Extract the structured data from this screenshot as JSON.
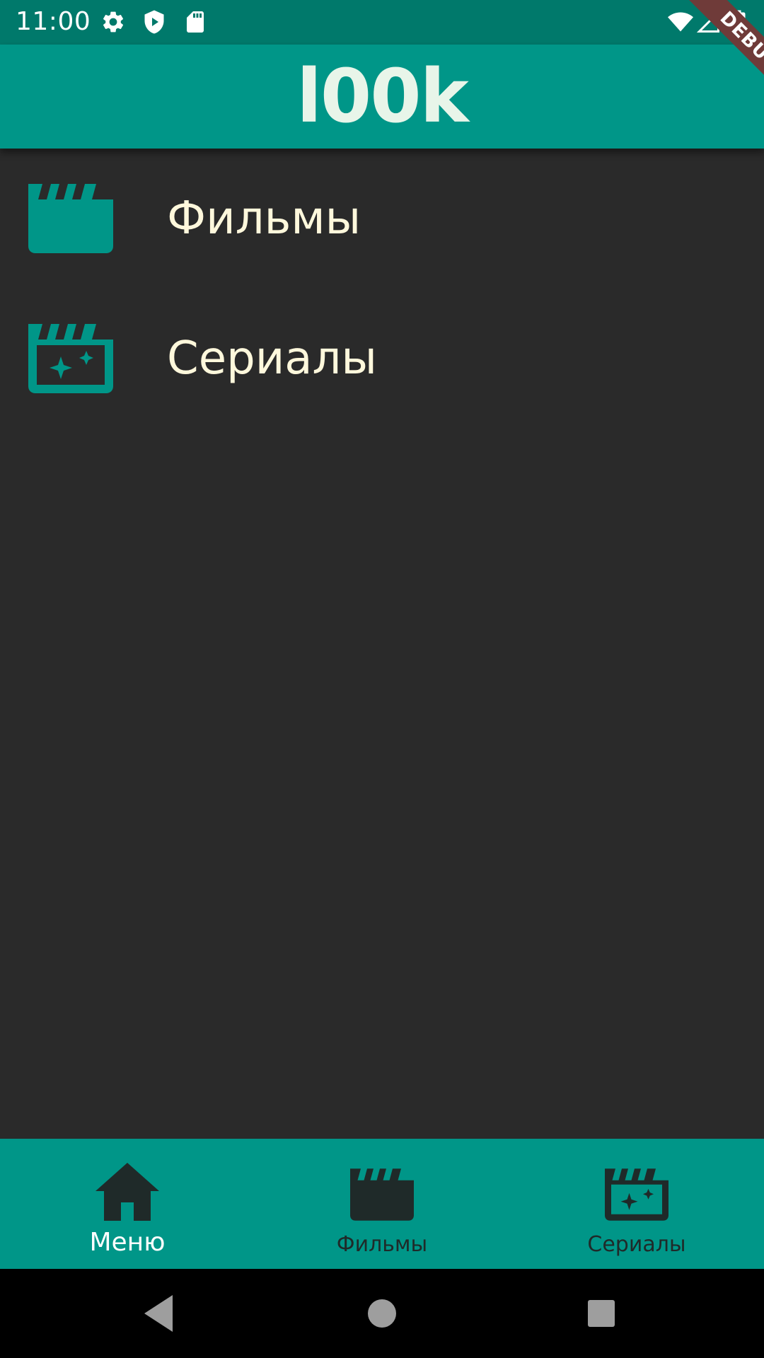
{
  "status_bar": {
    "time": "11:00",
    "icons": [
      "gear-icon",
      "play-protect-icon",
      "sd-card-icon",
      "wifi-icon",
      "signal-icon",
      "battery-icon"
    ]
  },
  "debug_banner": {
    "label": "DEBUG"
  },
  "app_bar": {
    "title": "l00k"
  },
  "menu": {
    "items": [
      {
        "label": "Фильмы",
        "icon": "movie-clapper-icon"
      },
      {
        "label": "Сериалы",
        "icon": "series-clapper-icon"
      }
    ]
  },
  "bottom_nav": {
    "items": [
      {
        "label": "Меню",
        "icon": "home-icon",
        "selected": true
      },
      {
        "label": "Фильмы",
        "icon": "movie-clapper-icon",
        "selected": false
      },
      {
        "label": "Сериалы",
        "icon": "series-clapper-icon",
        "selected": false
      }
    ]
  },
  "system_nav": {
    "buttons": [
      "back-icon",
      "home-circle-icon",
      "recents-icon"
    ]
  },
  "colors": {
    "status_bar": "#00796b",
    "accent": "#009688",
    "background": "#2a2a2a",
    "menu_text": "#fff8dc",
    "nav_selected": "#ffffff",
    "nav_unselected": "#1f2a29",
    "debug_ribbon": "#6f3b39"
  }
}
